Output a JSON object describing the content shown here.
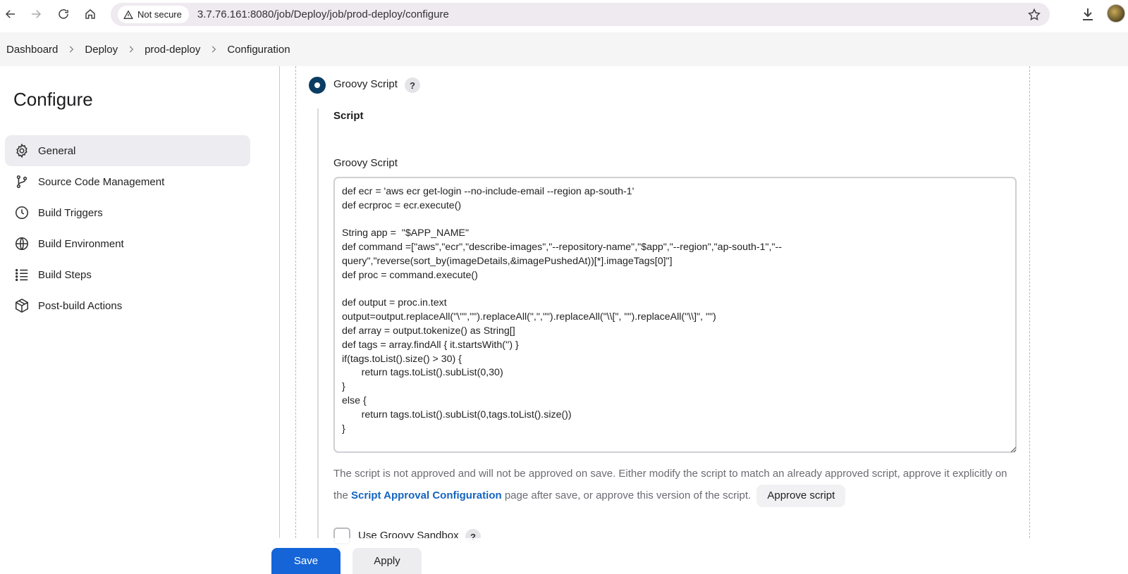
{
  "browser": {
    "security_label": "Not secure",
    "url": "3.7.76.161:8080/job/Deploy/job/prod-deploy/configure"
  },
  "breadcrumb": [
    "Dashboard",
    "Deploy",
    "prod-deploy",
    "Configuration"
  ],
  "sidebar": {
    "title": "Configure",
    "items": [
      {
        "label": "General",
        "icon": "gear-icon",
        "active": true
      },
      {
        "label": "Source Code Management",
        "icon": "branch-icon",
        "active": false
      },
      {
        "label": "Build Triggers",
        "icon": "clock-icon",
        "active": false
      },
      {
        "label": "Build Environment",
        "icon": "globe-icon",
        "active": false
      },
      {
        "label": "Build Steps",
        "icon": "list-icon",
        "active": false
      },
      {
        "label": "Post-build Actions",
        "icon": "package-icon",
        "active": false
      }
    ]
  },
  "main": {
    "radio_label": "Groovy Script",
    "help_symbol": "?",
    "script_section": "Script",
    "script_field_label": "Groovy Script",
    "script_code": "def ecr = 'aws ecr get-login --no-include-email --region ap-south-1'\ndef ecrproc = ecr.execute()\n\nString app =  \"$APP_NAME\"\ndef command =[\"aws\",\"ecr\",\"describe-images\",\"--repository-name\",\"$app\",\"--region\",\"ap-south-1\",\"--\nquery\",\"reverse(sort_by(imageDetails,&imagePushedAt))[*].imageTags[0]\"]\ndef proc = command.execute()\n\ndef output = proc.in.text\noutput=output.replaceAll(\"\\\"\",\"\").replaceAll(\",\",\"\").replaceAll(\"\\\\[\", \"\").replaceAll(\"\\\\]\", \"\")\ndef array = output.tokenize() as String[]\ndef tags = array.findAll { it.startsWith('') }\nif(tags.toList().size() > 30) {\n       return tags.toList().subList(0,30)\n}\nelse {\n       return tags.toList().subList(0,tags.toList().size())\n}",
    "warning_text_1": "The script is not approved and will not be approved on save. Either modify the script to match an already approved script, approve it explicitly on the ",
    "warning_link": "Script Approval Configuration",
    "warning_text_2": " page after save, or approve this version of the script.",
    "approve_button": "Approve script",
    "sandbox_label": "Use Groovy Sandbox"
  },
  "footer": {
    "save_label": "Save",
    "apply_label": "Apply"
  },
  "colors": {
    "primary_blue": "#1565d8",
    "radio_selected": "#0b3d62",
    "link": "#1565c0"
  }
}
